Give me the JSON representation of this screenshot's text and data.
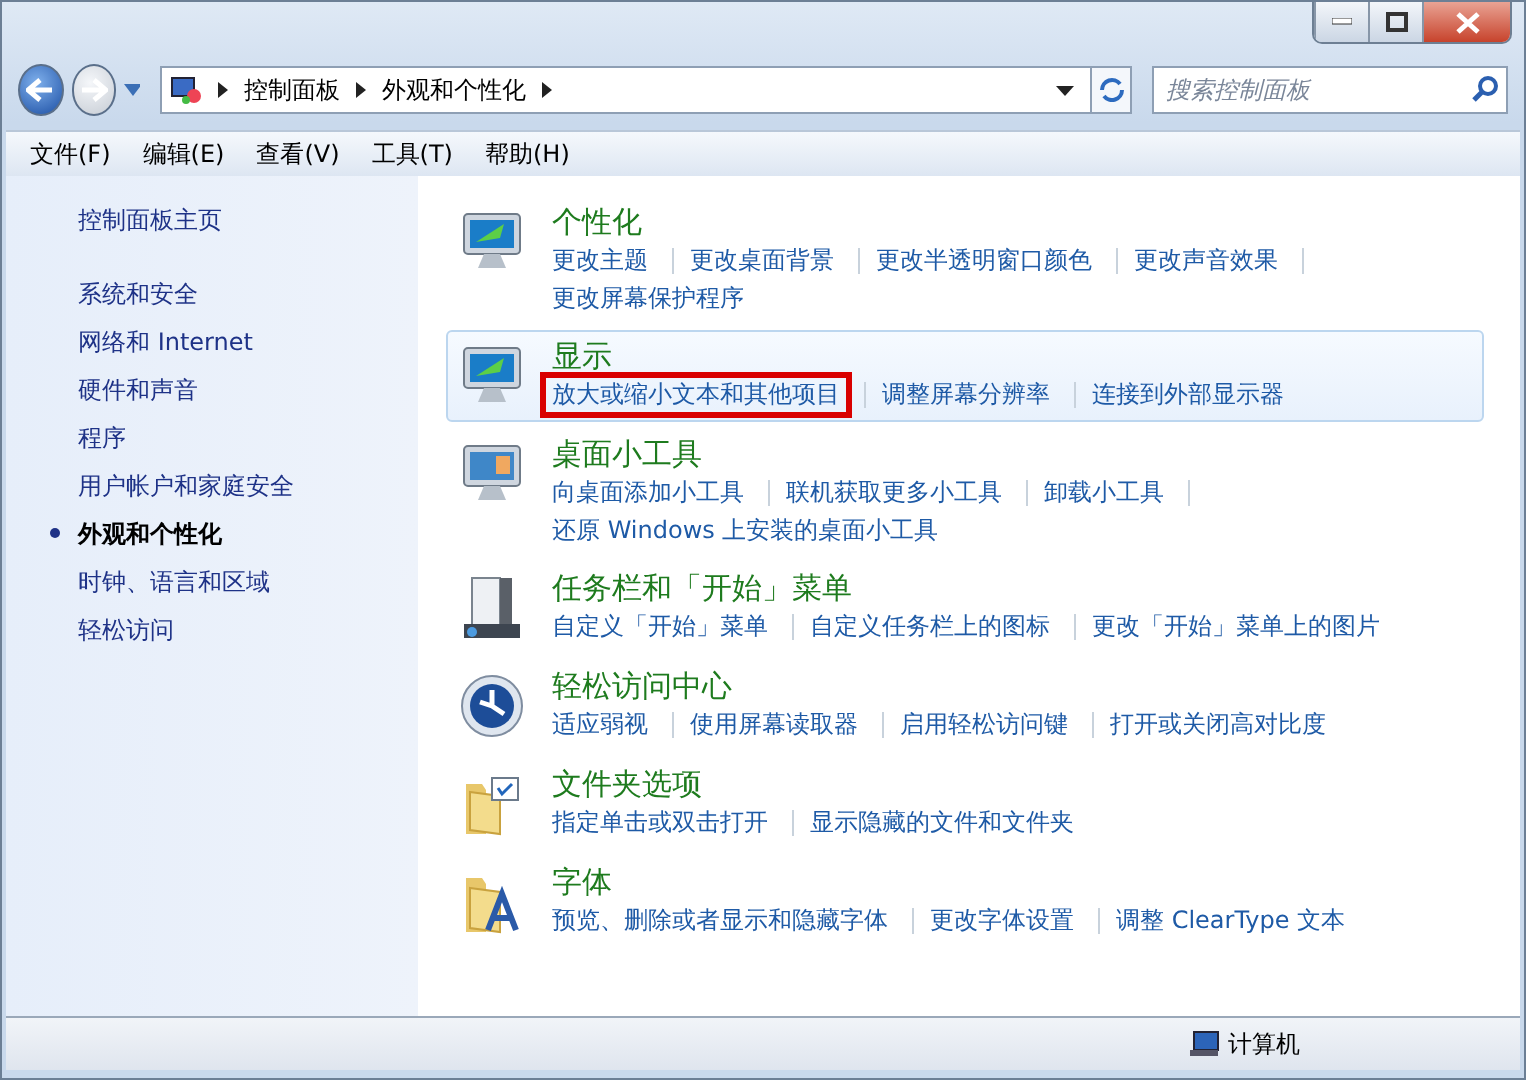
{
  "address_bar": {
    "crumbs": [
      "控制面板",
      "外观和个性化"
    ]
  },
  "search": {
    "placeholder": "搜索控制面板"
  },
  "menu": [
    "文件(F)",
    "编辑(E)",
    "查看(V)",
    "工具(T)",
    "帮助(H)"
  ],
  "sidebar": {
    "home": "控制面板主页",
    "items": [
      {
        "label": "系统和安全",
        "selected": false
      },
      {
        "label": "网络和 Internet",
        "selected": false
      },
      {
        "label": "硬件和声音",
        "selected": false
      },
      {
        "label": "程序",
        "selected": false
      },
      {
        "label": "用户帐户和家庭安全",
        "selected": false
      },
      {
        "label": "外观和个性化",
        "selected": true
      },
      {
        "label": "时钟、语言和区域",
        "selected": false
      },
      {
        "label": "轻松访问",
        "selected": false
      }
    ]
  },
  "categories": [
    {
      "kind": "personalize",
      "title": "个性化",
      "highlighted": false,
      "lines": [
        [
          {
            "label": "更改主题",
            "boxed": false
          },
          {
            "label": "更改桌面背景",
            "boxed": false
          },
          {
            "label": "更改半透明窗口颜色",
            "boxed": false
          },
          {
            "label": "更改声音效果",
            "boxed": false
          }
        ],
        [
          {
            "label": "更改屏幕保护程序",
            "boxed": false
          }
        ]
      ]
    },
    {
      "kind": "display",
      "title": "显示",
      "highlighted": true,
      "lines": [
        [
          {
            "label": "放大或缩小文本和其他项目",
            "boxed": true
          },
          {
            "label": "调整屏幕分辨率",
            "boxed": false
          },
          {
            "label": "连接到外部显示器",
            "boxed": false
          }
        ]
      ]
    },
    {
      "kind": "gadgets",
      "title": "桌面小工具",
      "highlighted": false,
      "lines": [
        [
          {
            "label": "向桌面添加小工具",
            "boxed": false
          },
          {
            "label": "联机获取更多小工具",
            "boxed": false
          },
          {
            "label": "卸载小工具",
            "boxed": false
          }
        ],
        [
          {
            "label": "还原 Windows 上安装的桌面小工具",
            "boxed": false
          }
        ]
      ]
    },
    {
      "kind": "taskbar",
      "title": "任务栏和「开始」菜单",
      "highlighted": false,
      "lines": [
        [
          {
            "label": "自定义「开始」菜单",
            "boxed": false
          },
          {
            "label": "自定义任务栏上的图标",
            "boxed": false
          },
          {
            "label": "更改「开始」菜单上的图片",
            "boxed": false
          }
        ]
      ]
    },
    {
      "kind": "access",
      "title": "轻松访问中心",
      "highlighted": false,
      "lines": [
        [
          {
            "label": "适应弱视",
            "boxed": false
          },
          {
            "label": "使用屏幕读取器",
            "boxed": false
          },
          {
            "label": "启用轻松访问键",
            "boxed": false
          },
          {
            "label": "打开或关闭高对比度",
            "boxed": false
          }
        ]
      ]
    },
    {
      "kind": "folder",
      "title": "文件夹选项",
      "highlighted": false,
      "lines": [
        [
          {
            "label": "指定单击或双击打开",
            "boxed": false
          },
          {
            "label": "显示隐藏的文件和文件夹",
            "boxed": false
          }
        ]
      ]
    },
    {
      "kind": "fonts",
      "title": "字体",
      "highlighted": false,
      "lines": [
        [
          {
            "label": "预览、删除或者显示和隐藏字体",
            "boxed": false
          },
          {
            "label": "更改字体设置",
            "boxed": false
          },
          {
            "label": "调整 ClearType 文本",
            "boxed": false
          }
        ]
      ]
    }
  ],
  "status_bar": {
    "location": "计算机"
  }
}
